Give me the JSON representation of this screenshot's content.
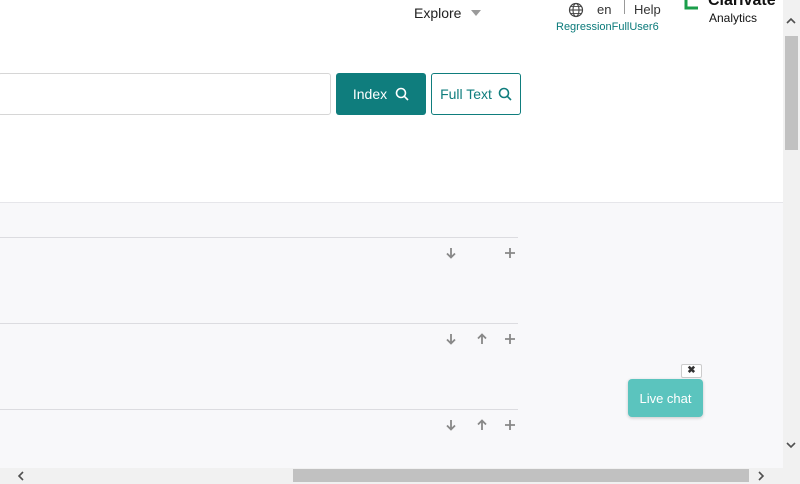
{
  "header": {
    "explore_label": "Explore",
    "language": "en",
    "help_label": "Help",
    "username": "RegressionFullUser6",
    "logo_line1": "Clarivate",
    "logo_line2": "Analytics"
  },
  "search": {
    "value": "",
    "placeholder": "",
    "index_label": "Index",
    "fulltext_label": "Full Text"
  },
  "live_chat": {
    "label": "Live chat",
    "close_glyph": "✖"
  },
  "colors": {
    "accent": "#0f7d7d",
    "live_chat": "#5bc4be"
  }
}
